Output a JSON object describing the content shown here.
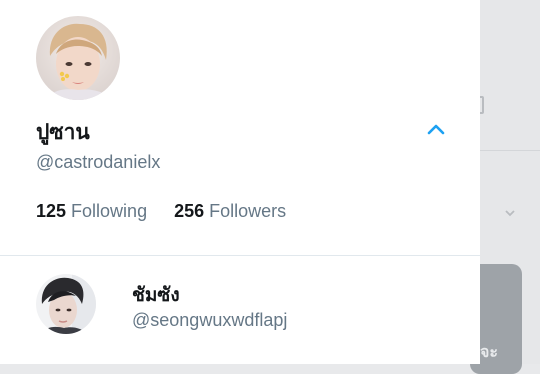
{
  "profile": {
    "display_name": "ปูซาน",
    "handle": "@castrodanielx",
    "following_count": "125",
    "following_label": "Following",
    "followers_count": "256",
    "followers_label": "Followers"
  },
  "accounts": [
    {
      "display_name": "ชัมซัง",
      "handle": "@seongwuxwdflapj"
    }
  ],
  "background": {
    "card_text": "จะ"
  },
  "colors": {
    "accent": "#1da1f2",
    "text_primary": "#14171a",
    "text_secondary": "#657786",
    "divider": "#e1e8ed",
    "background_dim": "#e8e9eb"
  },
  "icons": {
    "expand": "chevron-up-icon",
    "background_chevron": "chevron-down-icon"
  }
}
